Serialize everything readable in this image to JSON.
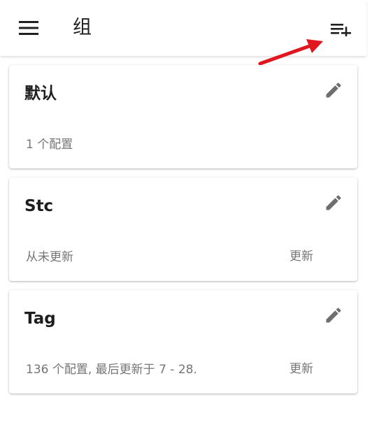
{
  "appbar": {
    "title": "组",
    "menu_icon": "menu-icon",
    "add_icon": "playlist-add-icon"
  },
  "annotation": {
    "number": "3",
    "color": "#e0171f"
  },
  "groups": [
    {
      "name": "默认",
      "subtitle": "1 个配置",
      "update_label": ""
    },
    {
      "name": "Stc",
      "subtitle": "从未更新",
      "update_label": "更新"
    },
    {
      "name": "Tag",
      "subtitle": "136 个配置, 最后更新于 7 - 28.",
      "update_label": "更新"
    }
  ]
}
